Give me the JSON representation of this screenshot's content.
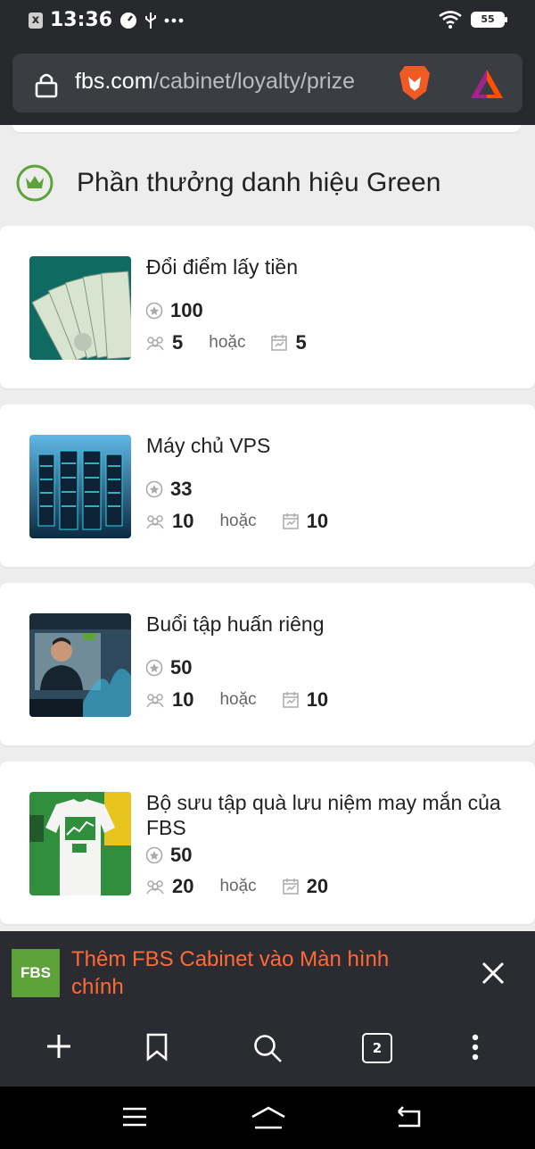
{
  "status_bar": {
    "time": "13:36",
    "battery": "55",
    "notification_x": "x"
  },
  "browser": {
    "url_domain": "fbs.com",
    "url_path": "/cabinet/loyalty/prize",
    "tab_count": "2"
  },
  "section": {
    "title": "Phần thưởng danh hiệu Green"
  },
  "or_label": "hoặc",
  "prizes": [
    {
      "title": "Đổi điểm lấy tiền",
      "points": "100",
      "referrals": "5",
      "days": "5"
    },
    {
      "title": "Máy chủ VPS",
      "points": "33",
      "referrals": "10",
      "days": "10"
    },
    {
      "title": "Buổi tập huấn riêng",
      "points": "50",
      "referrals": "10",
      "days": "10"
    },
    {
      "title": "Bộ sưu tập quà lưu niệm may mắn của FBS",
      "points": "50",
      "referrals": "20",
      "days": "20"
    }
  ],
  "install_banner": {
    "logo_text": "FBS",
    "text": "Thêm FBS Cabinet vào Màn hình chính"
  },
  "colors": {
    "banner_text": "#ff6a37",
    "brand_green": "#5ea33a",
    "dark_bar": "#27292d"
  }
}
